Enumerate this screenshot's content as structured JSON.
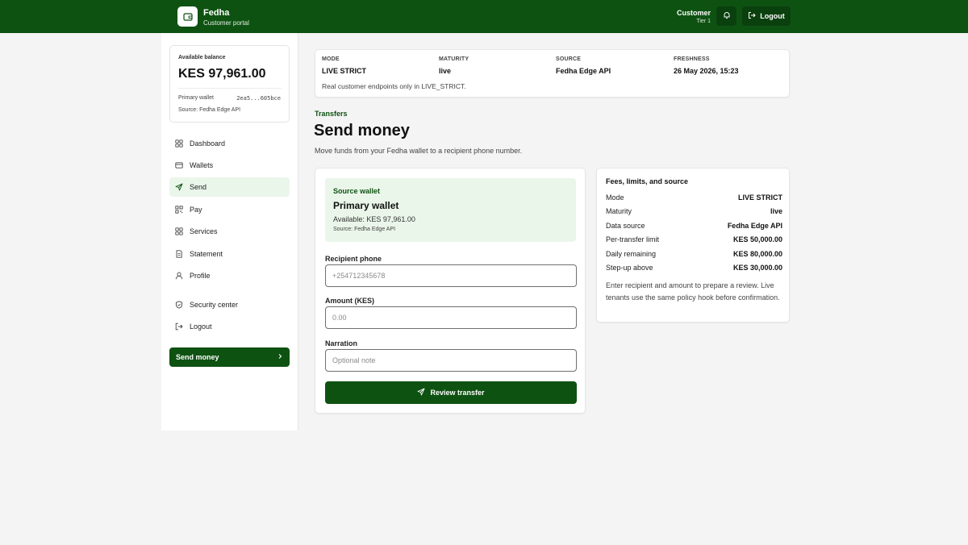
{
  "header": {
    "app_name": "Fedha",
    "app_subtitle": "Customer portal",
    "user_name": "Customer",
    "user_tier": "Tier 1",
    "logout_label": "Logout",
    "brand_color": "#0e5212"
  },
  "balance": {
    "label": "Available balance",
    "amount": "KES 97,961.00",
    "wallet_label": "Primary wallet",
    "wallet_id": "2ea5...605bce",
    "source": "Source: Fedha Edge API"
  },
  "nav": {
    "items": [
      {
        "label": "Dashboard",
        "icon": "grid-icon"
      },
      {
        "label": "Wallets",
        "icon": "wallet-icon"
      },
      {
        "label": "Send",
        "icon": "send-icon",
        "active": true
      },
      {
        "label": "Pay",
        "icon": "qr-icon"
      },
      {
        "label": "Services",
        "icon": "grid-icon"
      },
      {
        "label": "Statement",
        "icon": "document-icon"
      },
      {
        "label": "Profile",
        "icon": "user-icon"
      },
      {
        "label": "Security center",
        "icon": "shield-icon"
      },
      {
        "label": "Logout",
        "icon": "logout-icon"
      }
    ],
    "cta_label": "Send money"
  },
  "status": {
    "mode_label": "MODE",
    "mode_value": "LIVE STRICT",
    "maturity_label": "MATURITY",
    "maturity_value": "live",
    "source_label": "SOURCE",
    "source_value": "Fedha Edge API",
    "freshness_label": "FRESHNESS",
    "freshness_value": "26 May 2026, 15:23",
    "note": "Real customer endpoints only in LIVE_STRICT."
  },
  "page": {
    "breadcrumb": "Transfers",
    "title": "Send money",
    "description": "Move funds from your Fedha wallet to a recipient phone number."
  },
  "form": {
    "source_label": "Source wallet",
    "source_name": "Primary wallet",
    "source_available": "Available: KES 97,961.00",
    "source_origin": "Source: Fedha Edge API",
    "phone_label": "Recipient phone",
    "phone_placeholder": "+254712345678",
    "amount_label": "Amount (KES)",
    "amount_placeholder": "0.00",
    "narration_label": "Narration",
    "narration_placeholder": "Optional note",
    "submit_label": "Review transfer"
  },
  "fees": {
    "title": "Fees, limits, and source",
    "rows": [
      {
        "label": "Mode",
        "value": "LIVE STRICT"
      },
      {
        "label": "Maturity",
        "value": "live"
      },
      {
        "label": "Data source",
        "value": "Fedha Edge API"
      },
      {
        "label": "Per-transfer limit",
        "value": "KES 50,000.00"
      },
      {
        "label": "Daily remaining",
        "value": "KES 80,000.00"
      },
      {
        "label": "Step-up above",
        "value": "KES 30,000.00"
      }
    ],
    "note": "Enter recipient and amount to prepare a review. Live tenants use the same policy hook before confirmation."
  }
}
